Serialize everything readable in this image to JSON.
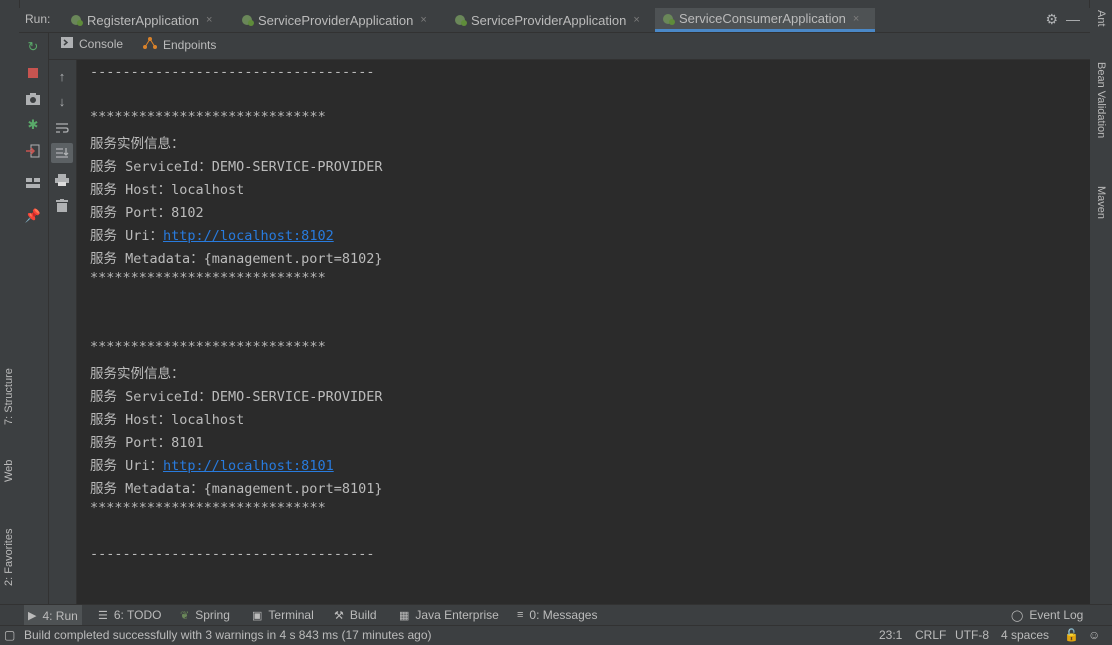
{
  "run_bar": {
    "label": "Run:",
    "tabs": [
      {
        "label": "RegisterApplication"
      },
      {
        "label": "ServiceProviderApplication"
      },
      {
        "label": "ServiceProviderApplication"
      },
      {
        "label": "ServiceConsumerApplication"
      }
    ],
    "close_glyph": "×"
  },
  "sub_tabs": [
    {
      "label": "Console"
    },
    {
      "label": "Endpoints"
    }
  ],
  "console": {
    "lines": [
      "-----------------------------------",
      "",
      "*****************************",
      "服务实例信息：",
      "服务 ServiceId：DEMO-SERVICE-PROVIDER",
      "服务 Host：localhost",
      "服务 Port：8102",
      "服务 Uri：",
      "服务 Metadata：{management.port=8102}",
      "*****************************",
      "",
      "*****************************",
      "服务实例信息：",
      "服务 ServiceId：DEMO-SERVICE-PROVIDER",
      "服务 Host：localhost",
      "服务 Port：8101",
      "服务 Uri：",
      "服务 Metadata：{management.port=8101}",
      "*****************************",
      "-----------------------------------"
    ],
    "link1": "http://localhost:8102",
    "link2": "http://localhost:8101"
  },
  "right_sidebar": {
    "ant": "Ant",
    "bean": "Bean Validation",
    "maven": "Maven"
  },
  "left_sidebar": {
    "structure": "7: Structure",
    "web": "Web",
    "favorites": "2: Favorites"
  },
  "bottom_tabs": [
    {
      "label": "4: Run"
    },
    {
      "label": "6: TODO"
    },
    {
      "label": "Spring"
    },
    {
      "label": "Terminal"
    },
    {
      "label": "Build"
    },
    {
      "label": "Java Enterprise"
    },
    {
      "label": "0: Messages"
    },
    {
      "label": "Event Log"
    }
  ],
  "status": {
    "message": "Build completed successfully with 3 warnings in 4 s 843 ms (17 minutes ago)",
    "position": "23:1",
    "line_sep": "CRLF",
    "encoding": "UTF-8",
    "indent": "4 spaces"
  },
  "colors": {
    "link": "#287bde",
    "spring_leaf": "#6a8759",
    "active_underline": "#4a88c7"
  }
}
